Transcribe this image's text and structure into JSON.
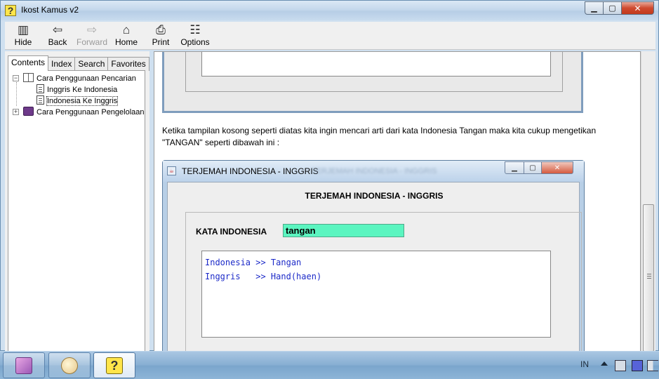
{
  "window": {
    "title": "Ikost Kamus v2",
    "caption": {
      "minimize": "▁",
      "maximize": "▢",
      "close": "✕"
    }
  },
  "toolbar": {
    "hide": {
      "label": "Hide",
      "icon": "▥"
    },
    "back": {
      "label": "Back",
      "icon": "⇦"
    },
    "forward": {
      "label": "Forward",
      "icon": "⇨"
    },
    "home": {
      "label": "Home",
      "icon": "⌂"
    },
    "print": {
      "label": "Print",
      "icon": "⎙"
    },
    "options": {
      "label": "Options",
      "icon": "☷"
    }
  },
  "nav_tabs": {
    "contents": "Contents",
    "index": "Index",
    "search": "Search",
    "favorites": "Favorites"
  },
  "tree": {
    "items": [
      {
        "label": "Cara Penggunaan Pencarian",
        "expander": "−"
      },
      {
        "label": "Inggris Ke Indonesia"
      },
      {
        "label": "Indonesia Ke Inggris"
      },
      {
        "label": "Cara Penggunaan Pengelolaan",
        "expander": "+"
      }
    ]
  },
  "content": {
    "paragraph": "Ketika tampilan kosong seperti diatas kita ingin mencari arti dari kata Indonesia Tangan maka kita cukup mengetikan \"TANGAN\" seperti dibawah ini :",
    "shot": {
      "window_title": "TERJEMAH INDONESIA - INGGRIS",
      "window_title_ghost": "TERJEMAH INDONESIA - INGGRIS",
      "caption": {
        "minimize": "▁",
        "maximize": "▢",
        "close": "✕"
      },
      "heading": "TERJEMAH INDONESIA - INGGRIS",
      "input_label": "KATA INDONESIA",
      "input_value": "tangan",
      "result_lines": [
        "Indonesia >> Tangan",
        "Inggris   >> Hand(haen)"
      ]
    }
  },
  "taskbar": {
    "language": "IN",
    "help_icon": "?"
  },
  "colors": {
    "input_highlight": "#5bf5c0",
    "result_text": "#1c2ac8",
    "close_button": "#cf4a2f"
  }
}
